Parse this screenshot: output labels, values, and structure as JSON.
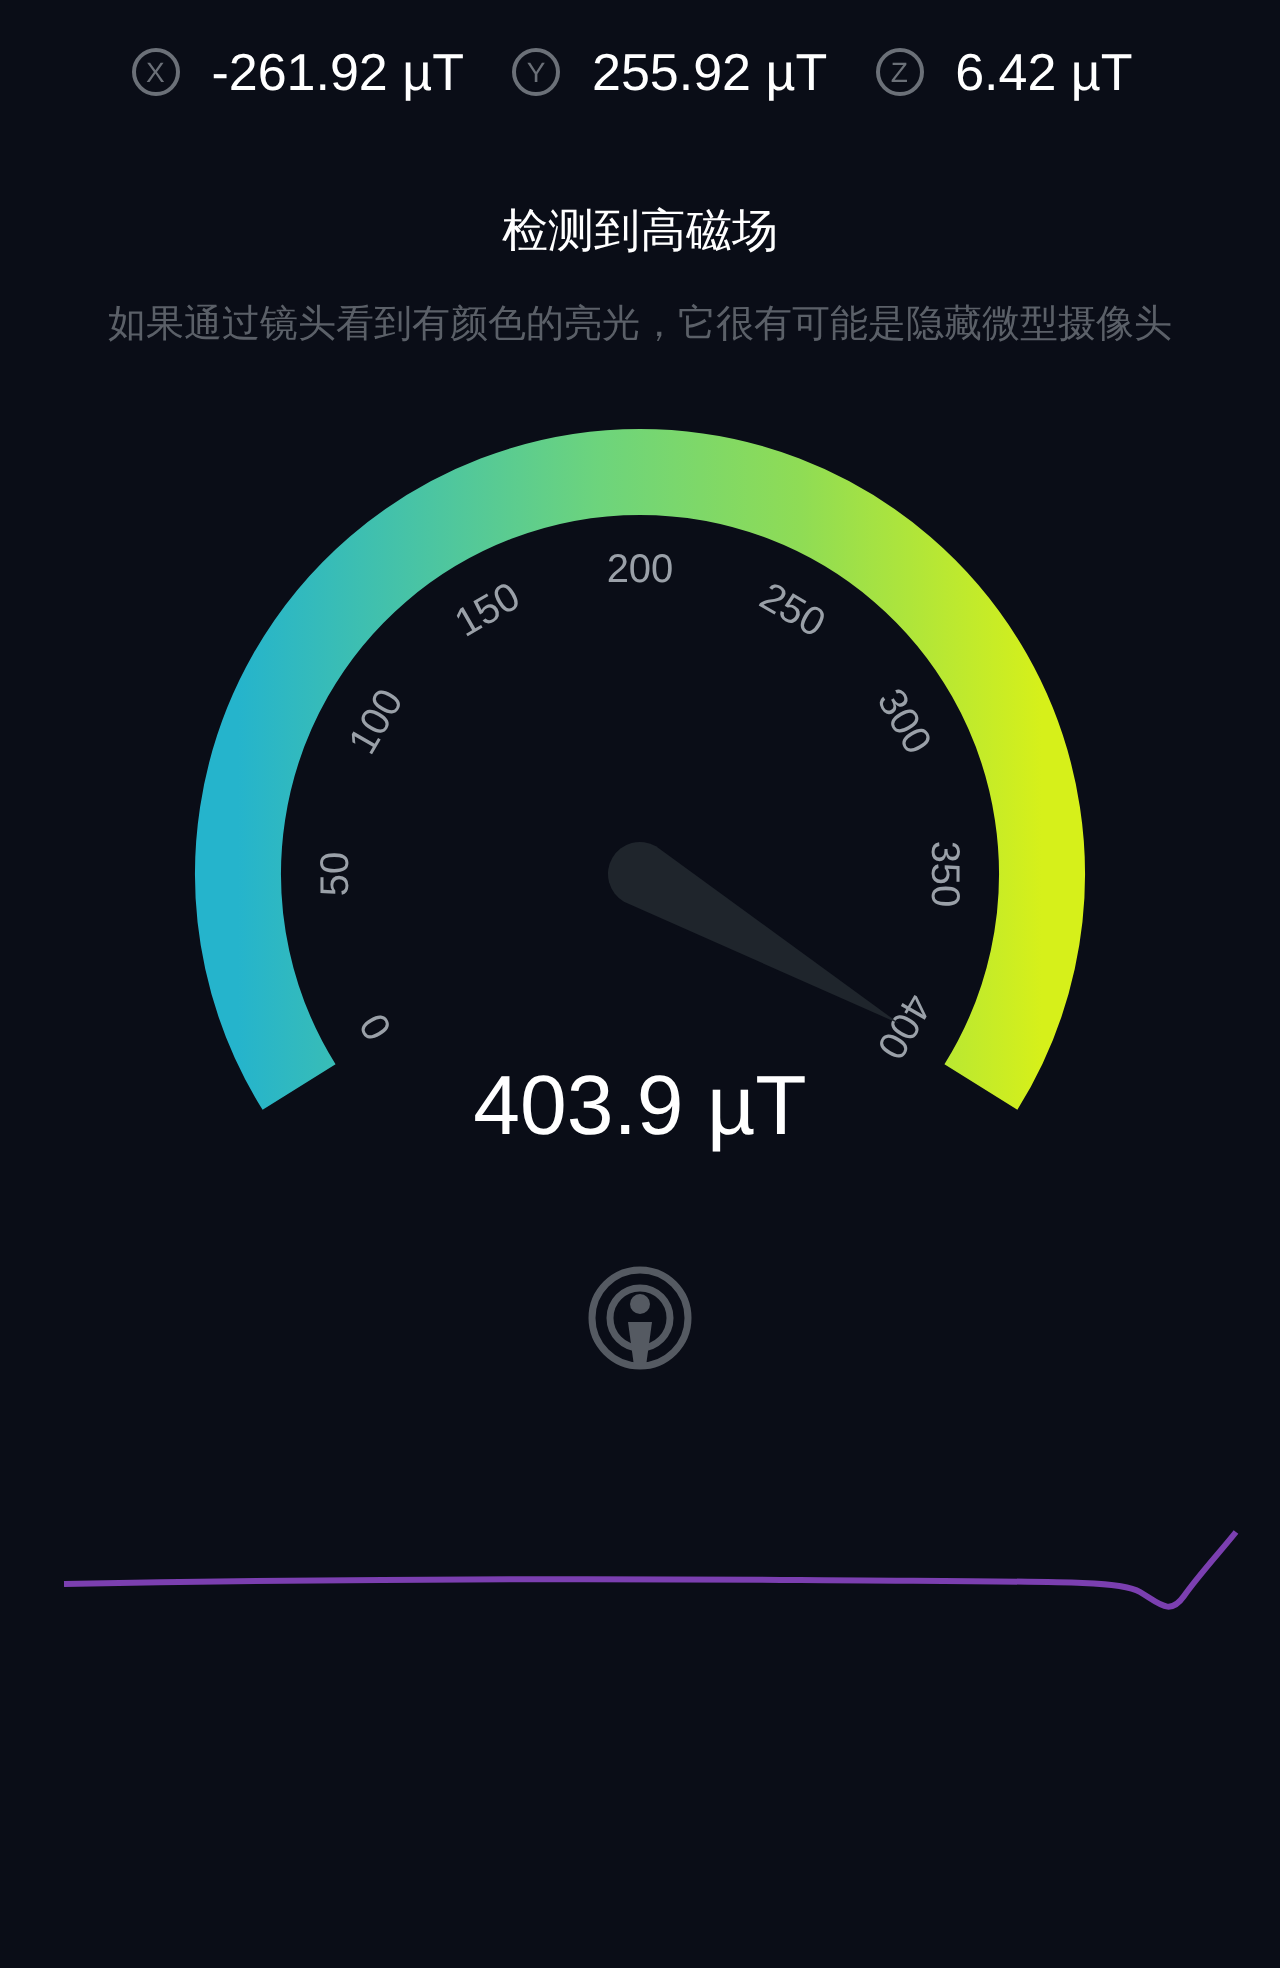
{
  "readings": [
    {
      "axis": "X",
      "value": "-261.92 µT"
    },
    {
      "axis": "Y",
      "value": "255.92 µT"
    },
    {
      "axis": "Z",
      "value": "6.42 µT"
    }
  ],
  "title": "检测到高磁场",
  "subtitle": "如果通过镜头看到有颜色的亮光，它很有可能是隐藏微型摄像头",
  "gauge": {
    "ticks": [
      "0",
      "50",
      "100",
      "150",
      "200",
      "250",
      "300",
      "350",
      "400"
    ],
    "reading": "403.9 µT"
  }
}
